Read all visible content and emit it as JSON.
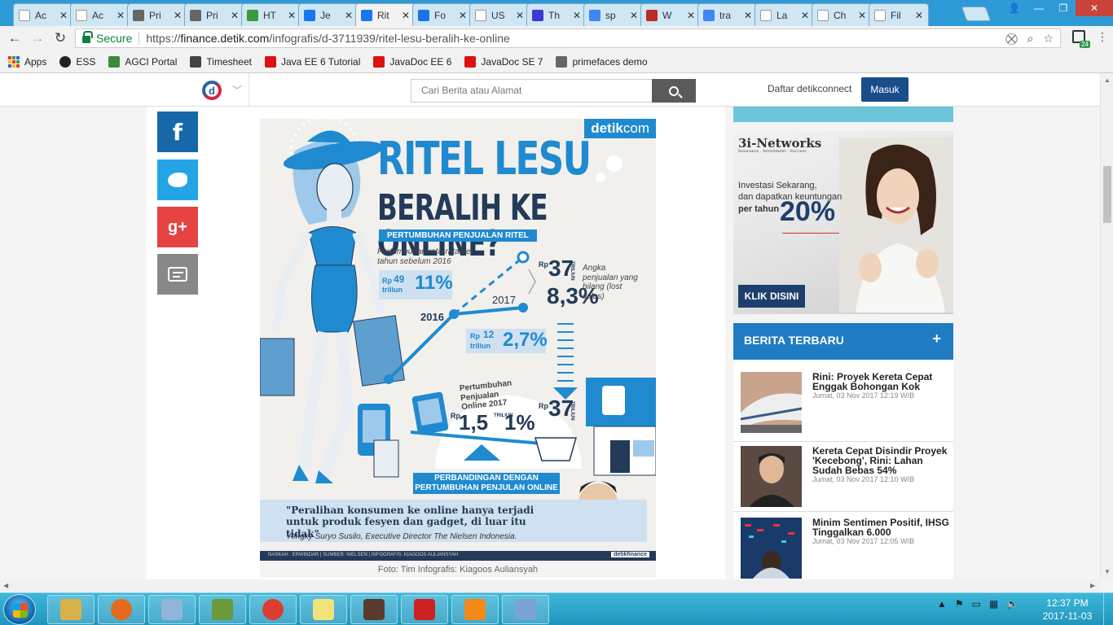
{
  "tabs": [
    {
      "label": "Ac",
      "icon": "document-icon",
      "color": "#ffffff"
    },
    {
      "label": "Ac",
      "icon": "document-icon",
      "color": "#ffffff"
    },
    {
      "label": "Pri",
      "icon": "shield-icon",
      "color": "#666666"
    },
    {
      "label": "Pri",
      "icon": "shield-icon",
      "color": "#666666"
    },
    {
      "label": "HT",
      "icon": "chart-icon",
      "color": "#3a9a3a"
    },
    {
      "label": "Je",
      "icon": "facebook-icon",
      "color": "#1877f2"
    },
    {
      "label": "Rit",
      "icon": "facebook-icon",
      "color": "#1877f2"
    },
    {
      "label": "Fo",
      "icon": "runner-icon",
      "color": "#1a73e8"
    },
    {
      "label": "US",
      "icon": "document-icon",
      "color": "#ffffff"
    },
    {
      "label": "Th",
      "icon": "b-icon",
      "color": "#3b3bd4"
    },
    {
      "label": "sp",
      "icon": "google-icon",
      "color": "#4285f4"
    },
    {
      "label": "W",
      "icon": "quora-icon",
      "color": "#b92b27"
    },
    {
      "label": "tra",
      "icon": "google-icon",
      "color": "#4285f4"
    },
    {
      "label": "La",
      "icon": "wikipedia-icon",
      "color": "#ffffff"
    },
    {
      "label": "Ch",
      "icon": "wikipedia-icon",
      "color": "#ffffff"
    },
    {
      "label": "Fil",
      "icon": "wikipedia-icon",
      "color": "#ffffff"
    }
  ],
  "active_tab": 6,
  "tab_close": "✕",
  "address": {
    "secure_label": "Secure",
    "url_prefix": "https://",
    "url_host": "finance.detik.com",
    "url_path": "/infografis/d-3711939/ritel-lesu-beralih-ke-online"
  },
  "extension_badge": "24",
  "bookmarks": [
    {
      "label": "Apps",
      "icon": "apps-grid-icon"
    },
    {
      "label": "ESS",
      "icon": "circle-icon"
    },
    {
      "label": "AGCI Portal",
      "icon": "globe-icon"
    },
    {
      "label": "Timesheet",
      "icon": "timesheet-icon"
    },
    {
      "label": "Java EE 6 Tutorial",
      "icon": "oracle-icon"
    },
    {
      "label": "JavaDoc EE 6",
      "icon": "oracle-icon"
    },
    {
      "label": "JavaDoc SE 7",
      "icon": "oracle-icon"
    },
    {
      "label": "primefaces demo",
      "icon": "shield-icon"
    }
  ],
  "site_header": {
    "logo_letter": "d",
    "search_placeholder": "Cari Berita atau Alamat",
    "register_label": "Daftar detikconnect",
    "login_label": "Masuk"
  },
  "share": {
    "facebook": "f",
    "googleplus": "g+"
  },
  "infographic": {
    "brand_a": "detik",
    "brand_b": "com",
    "title": "RITEL LESU",
    "subtitle": "BERALIH KE ONLINE?",
    "section_label": "PERTUMBUHAN PENJUALAN RITEL",
    "growth_note": "Pertumbuhan rata-rata per tahun sebelum 2016",
    "rp": "Rp",
    "val_49": "49",
    "triliun": "triliun",
    "pct_11": "11%",
    "year_2016": "2016",
    "year_2017": "2017",
    "val_37": "37",
    "triliun_caps": "TRILIUN",
    "pct_83": "8,3%",
    "lost_sales": "Angka penjualan yang hilang (lost sales)",
    "val_12": "12",
    "pct_27": "2,7%",
    "online_note": "Pertumbuhan Penjualan Online 2017",
    "val_15": "1,5",
    "pct_1": "1%",
    "val_37b": "37",
    "compare_label": "PERBANDINGAN DENGAN PERTUMBUHAN PENJULAN ONLINE",
    "quote": "\"Peralihan konsumen ke online hanya terjadi untuk produk fesyen dan gadget, di luar itu tidak\"",
    "attribution": "Yongky Suryo Susilo, Executive Director The Nielsen Indonesia.",
    "credits": "NASKAH : ERWINDAR | SUMBER: NIELSEN | INFOGRAFIS: KIAGOOS AULIANSYAH",
    "footer_brand": "detikfinance",
    "colors": {
      "blue": "#1f8ad0",
      "navy": "#233a58"
    }
  },
  "caption": "Foto: Tim Infografis: Kiagoos Auliansyah",
  "ad": {
    "logo": "3i-Networks",
    "logo_tag": "Insurance · Investment · Success",
    "line1": "Investasi Sekarang,",
    "line2": "dan dapatkan keuntungan",
    "line3": "per tahun",
    "percent": "20%",
    "cta": "KLIK DISINI"
  },
  "berita": {
    "title": "BERITA TERBARU",
    "plus": "+",
    "items": [
      {
        "title": "Rini: Proyek Kereta Cepat Enggak Bohongan Kok",
        "date": "Jumat, 03 Nov 2017 12:19 WIB"
      },
      {
        "title": "Kereta Cepat Disindir Proyek 'Kecebong', Rini: Lahan Sudah Bebas 54%",
        "date": "Jumat, 03 Nov 2017 12:10 WIB"
      },
      {
        "title": "Minim Sentimen Positif, IHSG Tinggalkan 6.000",
        "date": "Jumat, 03 Nov 2017 12:05 WIB"
      }
    ]
  },
  "taskbar": {
    "apps": [
      "explorer-icon",
      "firefox-icon",
      "notepad-icon",
      "chart-app-icon",
      "chrome-icon",
      "sticky-notes-icon",
      "java-ee-ide-icon",
      "pdf-icon",
      "vlc-icon",
      "paint-icon"
    ],
    "app_colors": [
      "#d9b14a",
      "#e66a1d",
      "#8fb6d9",
      "#6a9a3a",
      "#dc3d32",
      "#f3e27a",
      "#5a3a2a",
      "#cc2222",
      "#f28a1a",
      "#7aa4d6"
    ],
    "time": "12:37 PM",
    "date": "2017-11-03"
  }
}
